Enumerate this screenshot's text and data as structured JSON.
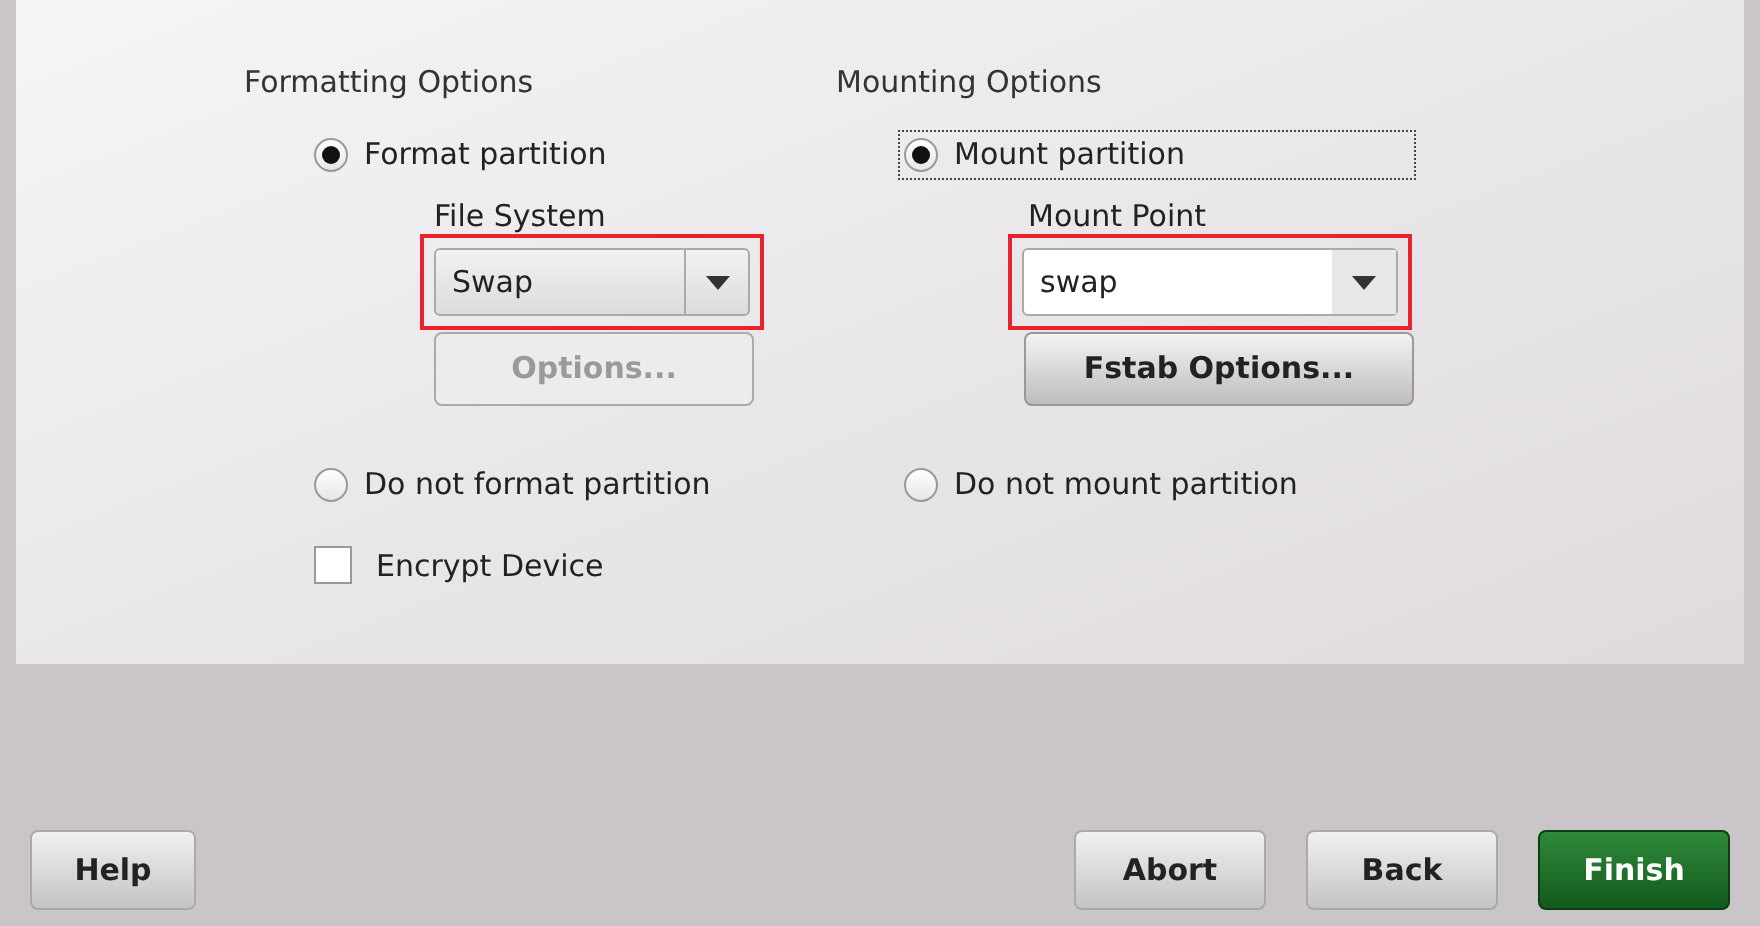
{
  "formatting": {
    "title": "Formatting Options",
    "format_radio": {
      "label": "Format partition",
      "selected": true,
      "focused": false
    },
    "file_system": {
      "label": "File System",
      "value": "Swap",
      "highlighted": true
    },
    "options_button": {
      "label": "Options...",
      "disabled": true
    },
    "no_format_radio": {
      "label": "Do not format partition",
      "selected": false,
      "focused": false
    },
    "encrypt": {
      "label": "Encrypt Device",
      "checked": false
    }
  },
  "mounting": {
    "title": "Mounting Options",
    "mount_radio": {
      "label": "Mount partition",
      "selected": true,
      "focused": true
    },
    "mount_point": {
      "label": "Mount Point",
      "value": "swap",
      "highlighted": true
    },
    "fstab_button": {
      "label": "Fstab Options...",
      "disabled": false
    },
    "no_mount_radio": {
      "label": "Do not mount partition",
      "selected": false,
      "focused": false
    }
  },
  "buttons": [
    {
      "label": "Help",
      "kind": "normal"
    },
    {
      "label": "Abort",
      "kind": "normal"
    },
    {
      "label": "Back",
      "kind": "normal"
    },
    {
      "label": "Finish",
      "kind": "default"
    }
  ]
}
